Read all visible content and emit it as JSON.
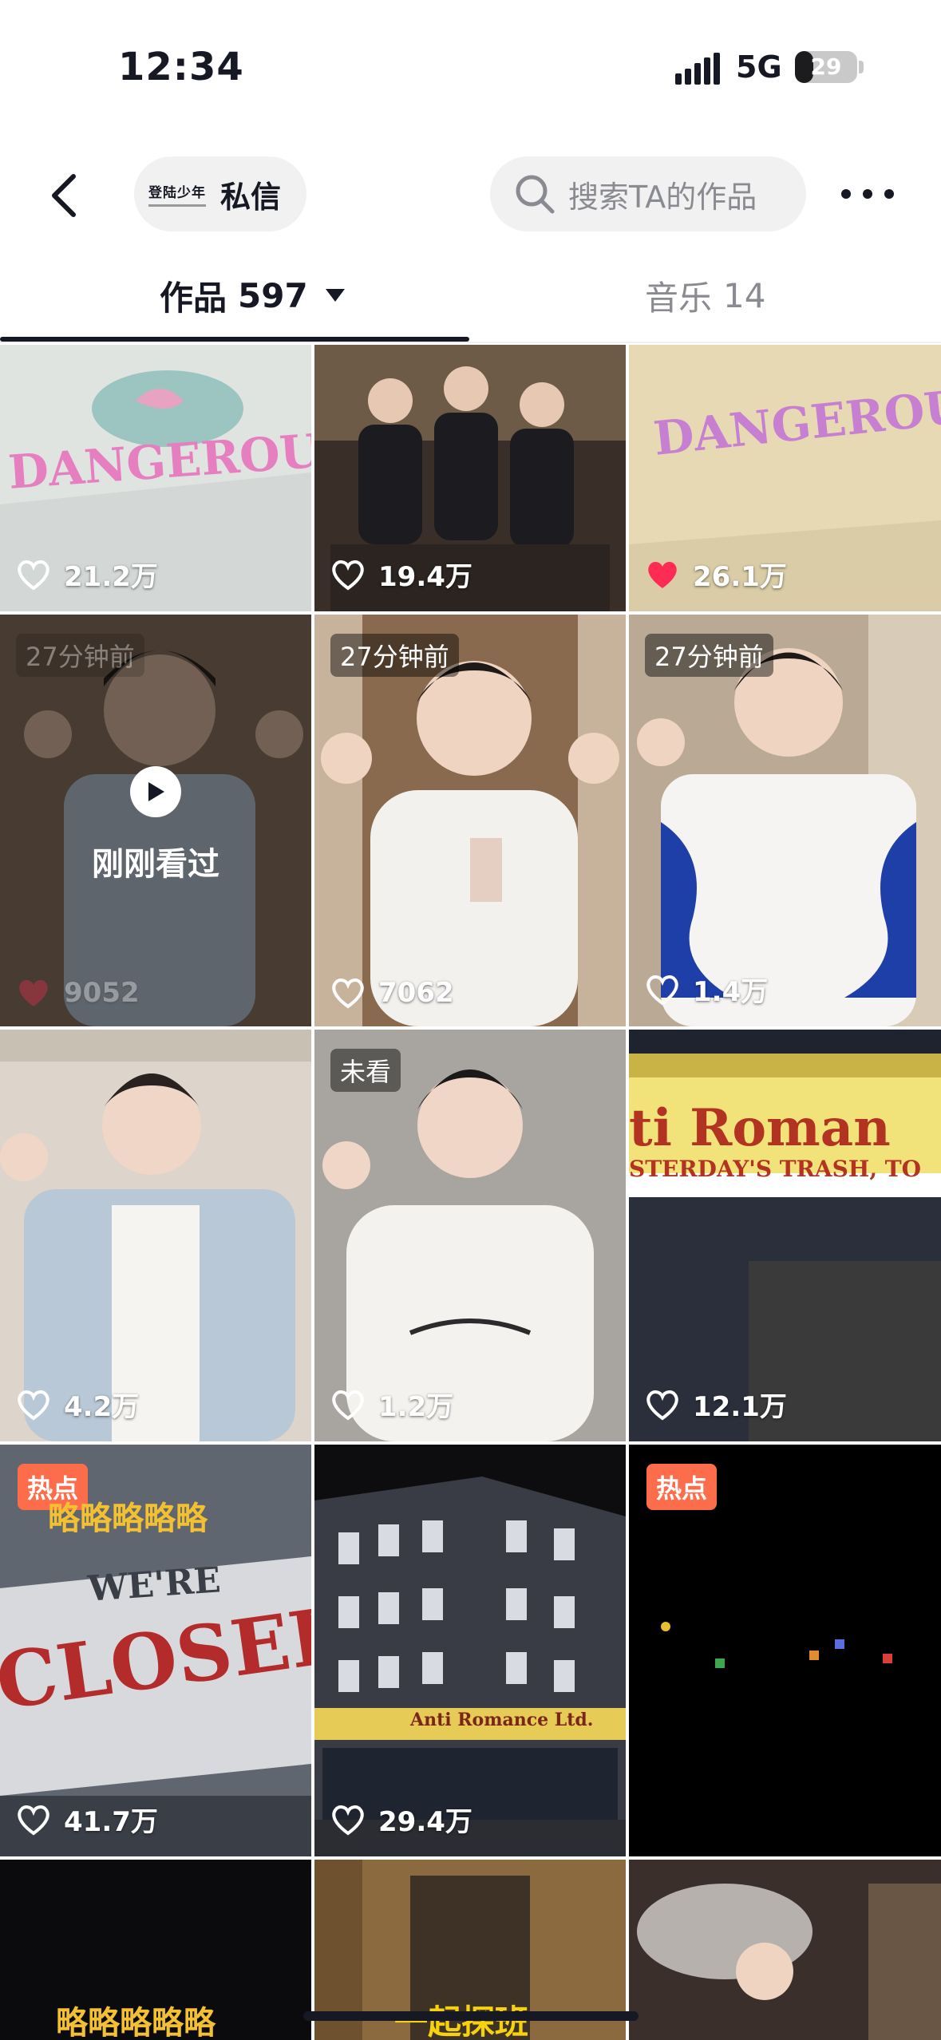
{
  "status_bar": {
    "time": "12:34",
    "network": "5G",
    "battery": "29",
    "battery_level": 0.29
  },
  "header": {
    "back_icon": "chevron-left-icon",
    "dm_logo_text": "登陆少年",
    "dm_label": "私信",
    "search_placeholder": "搜索TA的作品",
    "more_icon": "ellipsis-icon"
  },
  "tabs": [
    {
      "name": "作品",
      "count": "597",
      "active": true
    },
    {
      "name": "音乐",
      "count": "14",
      "active": false
    }
  ],
  "colors": {
    "accent_red": "#fe2c55",
    "hot_badge": "#fe6d4b",
    "text_primary": "#161823",
    "text_secondary": "#8a8b91"
  },
  "grid": {
    "recent_label": "刚刚看过",
    "tiles": [
      {
        "likes": "21.2万",
        "liked": false,
        "sign": "DANGEROUS!"
      },
      {
        "likes": "19.4万",
        "liked": false
      },
      {
        "likes": "26.1万",
        "liked": true,
        "sign": "DANGEROUS!"
      },
      {
        "likes": "9052",
        "liked": true,
        "badge": "27分钟前"
      },
      {
        "likes": "7062",
        "liked": false,
        "badge": "27分钟前"
      },
      {
        "likes": "1.4万",
        "liked": false,
        "badge": "27分钟前"
      },
      {
        "likes": "4.2万",
        "liked": false
      },
      {
        "likes": "1.2万",
        "liked": false,
        "badge": "未看"
      },
      {
        "likes": "12.1万",
        "liked": false,
        "sign": "ti Roman",
        "sign2": "STERDAY'S TRASH, TO"
      },
      {
        "likes": "41.7万",
        "liked": false,
        "badge": "热点",
        "sign": "CLOSED",
        "sign2": "WE'RE",
        "title": "略略略略略"
      },
      {
        "likes": "29.4万",
        "liked": false,
        "sign": "Anti Romance Ltd."
      },
      {
        "likes": "",
        "liked": false,
        "badge": "热点"
      },
      {
        "likes": "",
        "liked": false,
        "title": "略略略略略"
      },
      {
        "likes": "",
        "liked": false,
        "title": "一起探班"
      },
      {
        "likes": "",
        "liked": false
      }
    ]
  }
}
